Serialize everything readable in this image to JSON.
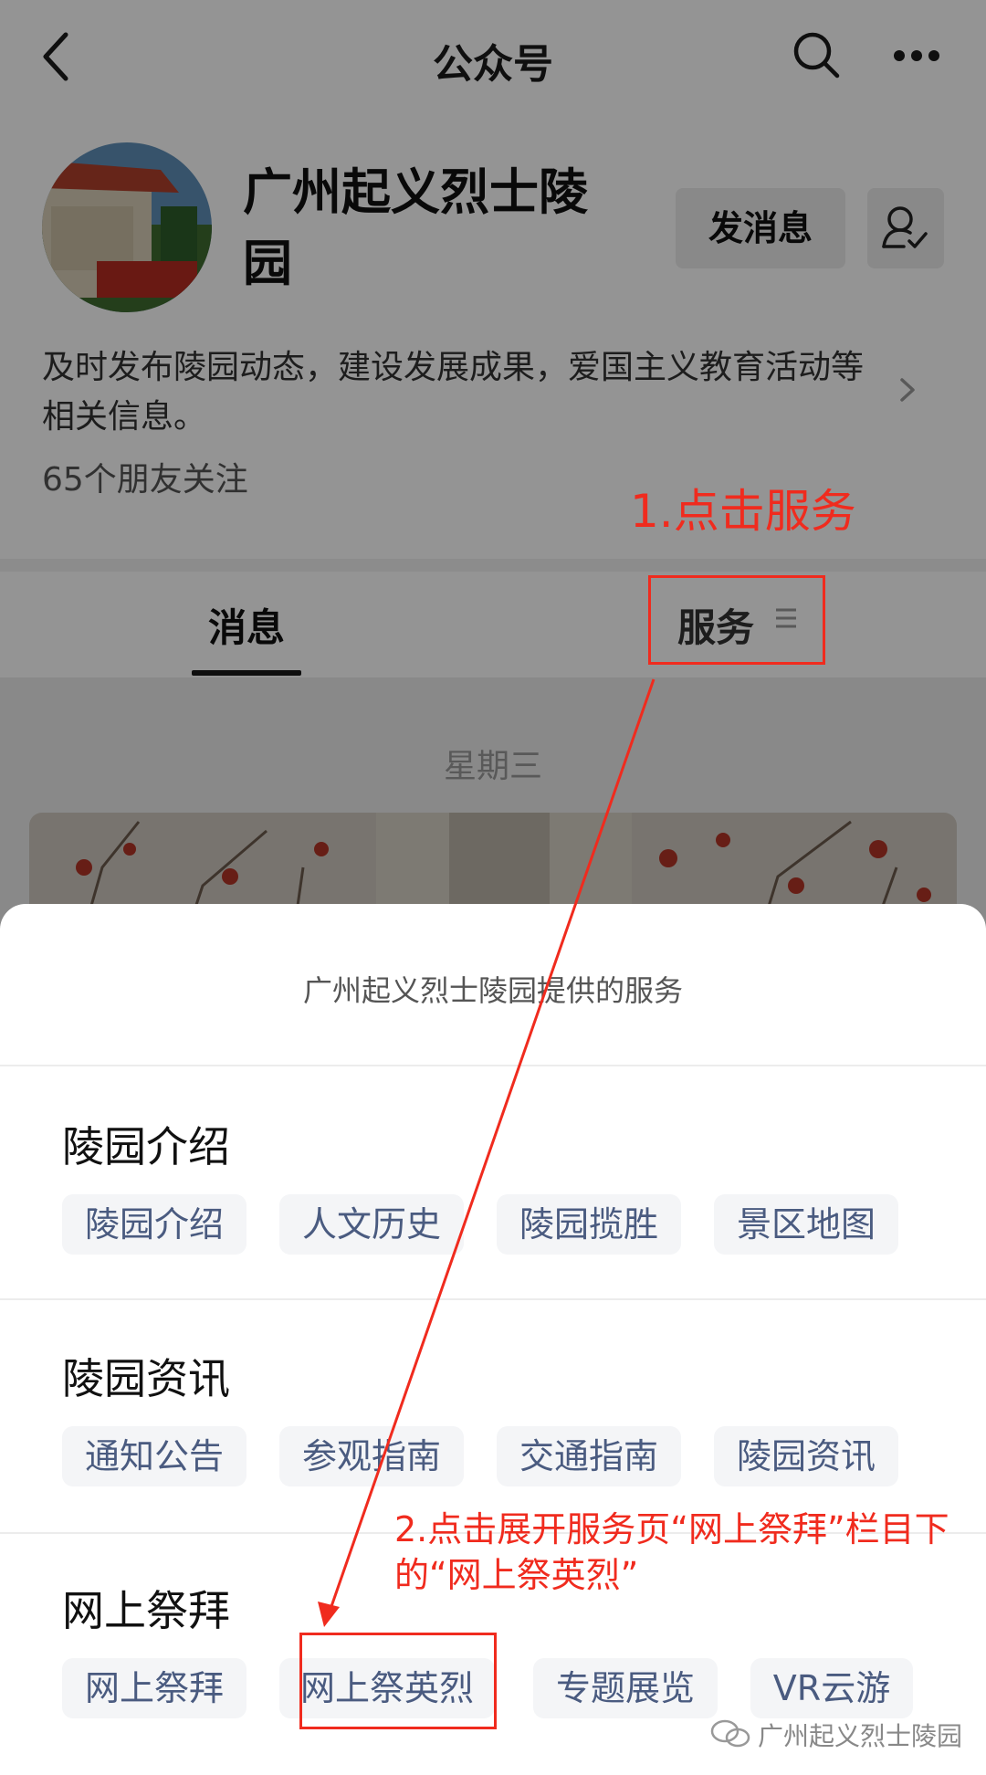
{
  "nav": {
    "title": "公众号"
  },
  "account": {
    "name": "广州起义烈士陵园",
    "message_button": "发消息",
    "description": "及时发布陵园动态，建设发展成果，爱国主义教育活动等相关信息。",
    "friends_following": "65个朋友关注"
  },
  "tabs": {
    "messages": "消息",
    "services": "服务"
  },
  "feed": {
    "date": "星期三"
  },
  "sheet": {
    "title": "广州起义烈士陵园提供的服务",
    "sections": [
      {
        "title": "陵园介绍",
        "chips": [
          "陵园介绍",
          "人文历史",
          "陵园揽胜",
          "景区地图"
        ]
      },
      {
        "title": "陵园资讯",
        "chips": [
          "通知公告",
          "参观指南",
          "交通指南",
          "陵园资讯"
        ]
      },
      {
        "title": "网上祭拜",
        "chips": [
          "网上祭拜",
          "网上祭英烈",
          "专题展览",
          "VR云游"
        ]
      }
    ]
  },
  "annotations": {
    "step1": "1.点击服务",
    "step2": "2.点击展开服务页“网上祭拜”栏目下的“网上祭英烈”",
    "color": "#f02b1e"
  },
  "watermark": {
    "text": "广州起义烈士陵园"
  },
  "icons": [
    "back-arrow-icon",
    "search-icon",
    "more-icon",
    "user-check-icon",
    "chevron-right-icon",
    "menu-icon",
    "wechat-icon"
  ]
}
